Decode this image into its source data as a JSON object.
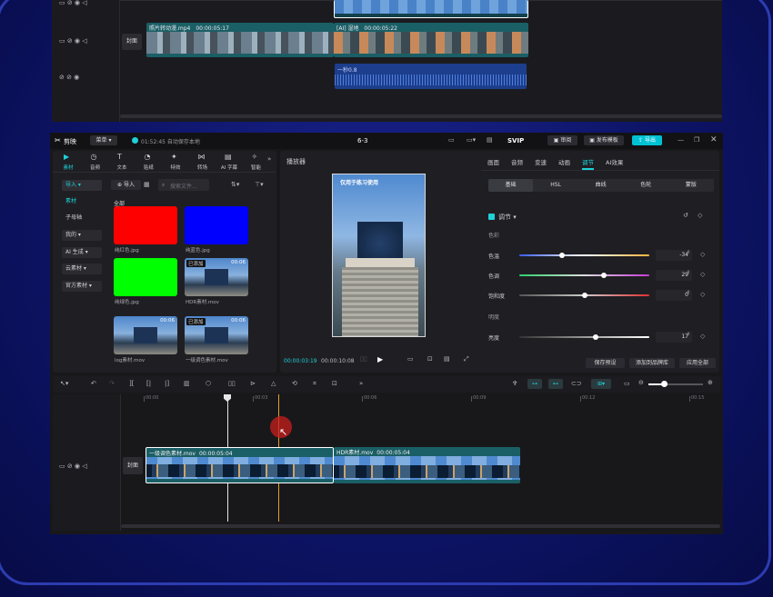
{
  "top_window": {
    "clip1": {
      "name": "照片转动漫.mp4",
      "duration": "00:00:05:17"
    },
    "clip2": {
      "name": "[AI] 湿地",
      "duration": "00:00:05:22"
    },
    "audio_label": "一秒0.8",
    "cover_label": "封面"
  },
  "app": {
    "name": "剪映",
    "menu": "菜单",
    "save_status": "01:52:45 自动保存本地",
    "project": "6-3",
    "svip": "SVIP",
    "review": "审阅",
    "publish": "发布模板",
    "export": "导出"
  },
  "toolbar_tabs": [
    {
      "icon": "media-icon",
      "label": "素材"
    },
    {
      "icon": "audio-icon",
      "label": "音频"
    },
    {
      "icon": "text-icon",
      "label": "文本"
    },
    {
      "icon": "sticker-icon",
      "label": "贴纸"
    },
    {
      "icon": "effects-icon",
      "label": "特效"
    },
    {
      "icon": "transition-icon",
      "label": "转场"
    },
    {
      "icon": "subtitle-icon",
      "label": "AI 字幕"
    },
    {
      "icon": "smart-icon",
      "label": "智能"
    }
  ],
  "media": {
    "import_nav": "导入",
    "nav": [
      "素材",
      "子母轴",
      "我的",
      "AI 生成",
      "云素材",
      "官方素材"
    ],
    "import_btn": "导入",
    "search_placeholder": "搜索文件...",
    "section": "全部",
    "items": [
      {
        "name": "纯红色.jpg",
        "color": "#ff0000"
      },
      {
        "name": "纯蓝色.jpg",
        "color": "#0000ff"
      },
      {
        "name": "纯绿色.jpg",
        "color": "#00ff00"
      },
      {
        "name": "HDR素材.mov",
        "badge": "已添加",
        "duration": "00:06"
      },
      {
        "name": "log素材.mov",
        "duration": "00:06"
      },
      {
        "name": "一级调色素材.mov",
        "badge": "已添加",
        "duration": "00:06"
      }
    ]
  },
  "player": {
    "title": "播放器",
    "video_caption": "仅用于练习使用",
    "current": "00:00:03:19",
    "total": "00:00:10:08"
  },
  "inspector": {
    "tabs": [
      "画面",
      "音频",
      "变速",
      "动画",
      "调节",
      "AI效果"
    ],
    "subtabs": [
      "基础",
      "HSL",
      "曲线",
      "色轮",
      "蒙版"
    ],
    "section": "调节",
    "color_group": "色彩",
    "light_group": "明度",
    "params": [
      {
        "label": "色温",
        "value": "-34",
        "pos": 0.33
      },
      {
        "label": "色调",
        "value": "29",
        "pos": 0.65
      },
      {
        "label": "饱和度",
        "value": "0",
        "pos": 0.5
      },
      {
        "label": "亮度",
        "value": "17",
        "pos": 0.59
      }
    ],
    "buttons": [
      "保存预设",
      "添加到品牌库",
      "应用全部"
    ]
  },
  "timeline": {
    "ticks": [
      "00:00",
      "00:03",
      "00:06",
      "00:09",
      "00:12",
      "00:15"
    ],
    "cover_label": "封面",
    "clips": [
      {
        "name": "一级调色素材.mov",
        "duration": "00:00:05:04"
      },
      {
        "name": "HDR素材.mov",
        "duration": "00:00:05:04"
      }
    ]
  },
  "colors": {
    "accent": "#1fd1d8",
    "export": "#00c2d4",
    "selected": "#ffffff"
  }
}
